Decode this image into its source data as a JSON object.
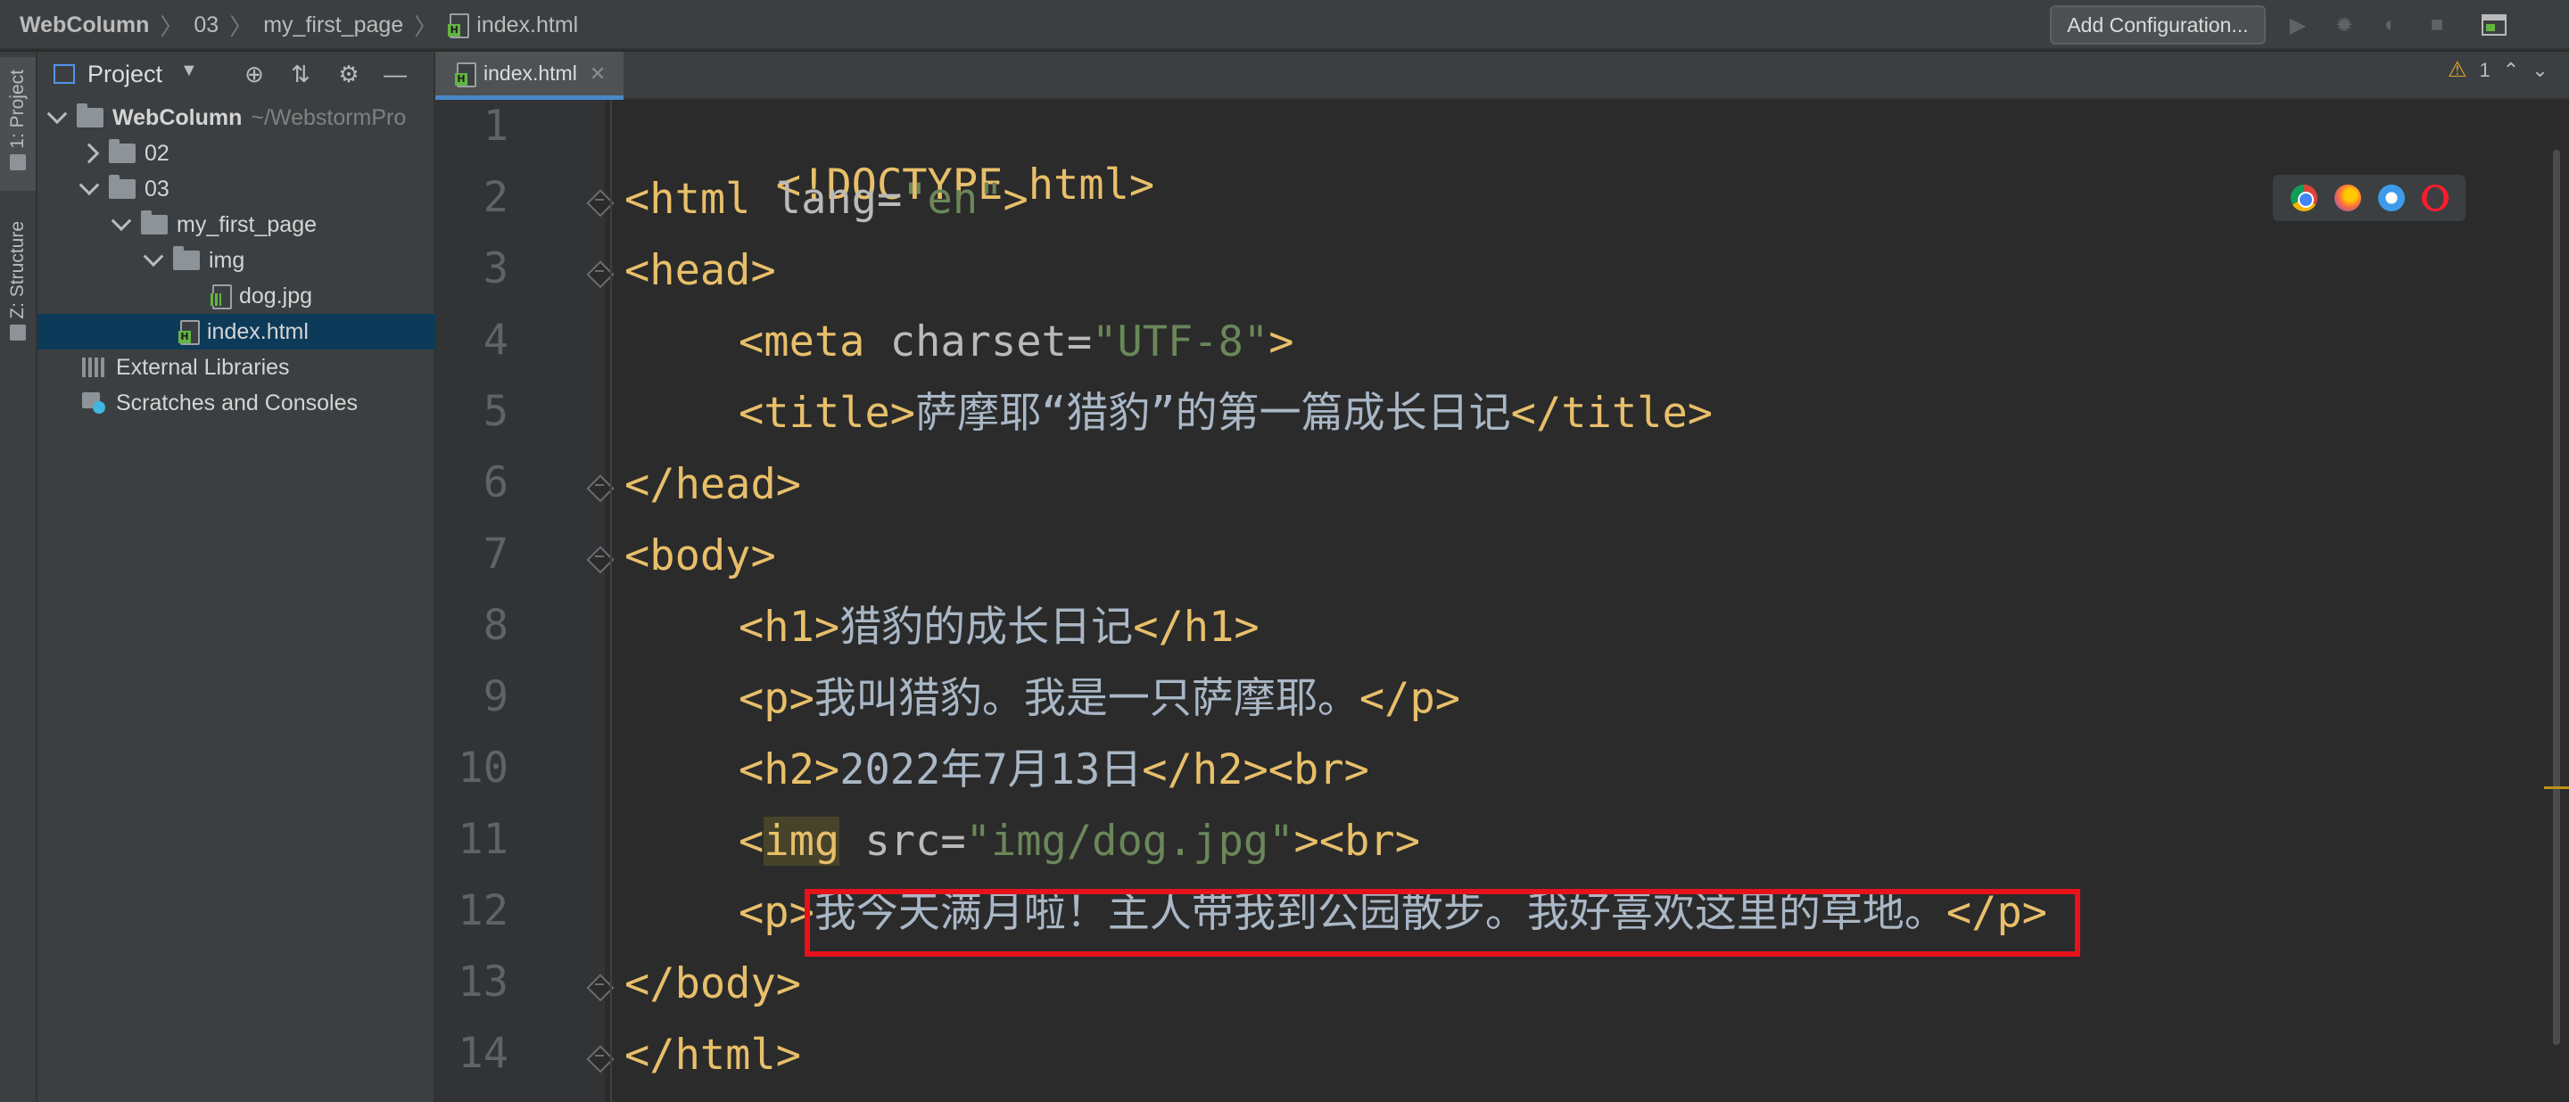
{
  "breadcrumb": [
    {
      "label": "WebColumn"
    },
    {
      "label": "03"
    },
    {
      "label": "my_first_page"
    },
    {
      "label": "index.html"
    }
  ],
  "toolbar": {
    "add_configuration": "Add Configuration...",
    "icons": [
      "run-icon",
      "debug-icon",
      "coverage-icon",
      "stop-icon",
      "layout-icon"
    ]
  },
  "side_stripe": {
    "project": "1: Project",
    "structure": "Z: Structure"
  },
  "project_panel": {
    "title": "Project",
    "tree": [
      {
        "label": "WebColumn",
        "hint": "~/WebstormPro"
      },
      {
        "label": "02"
      },
      {
        "label": "03"
      },
      {
        "label": "my_first_page"
      },
      {
        "label": "img"
      },
      {
        "label": "dog.jpg"
      },
      {
        "label": "index.html"
      },
      {
        "label": "External Libraries"
      },
      {
        "label": "Scratches and Consoles"
      }
    ]
  },
  "editor": {
    "tab": "index.html",
    "warnings": "1",
    "line_numbers": [
      "1",
      "2",
      "3",
      "4",
      "5",
      "6",
      "7",
      "8",
      "9",
      "10",
      "11",
      "12",
      "13",
      "14"
    ],
    "code": {
      "l1": "<!DOCTYPE html>",
      "l2_tag": "<html ",
      "l2_attr": "lang=",
      "l2_val": "\"en\"",
      "l2_end": ">",
      "l3": "<head>",
      "l4_tag": "<meta ",
      "l4_attr": "charset=",
      "l4_val": "\"UTF-8\"",
      "l4_end": ">",
      "l5_open": "<title>",
      "l5_text": "萨摩耶“猎豹”的第一篇成长日记",
      "l5_close": "</title>",
      "l6": "</head>",
      "l7": "<body>",
      "l8_open": "<h1>",
      "l8_text": "猎豹的成长日记",
      "l8_close": "</h1>",
      "l9_open": "<p>",
      "l9_text": "我叫猎豹。我是一只萨摩耶。",
      "l9_close": "</p>",
      "l10_open": "<h2>",
      "l10_text": "2022年7月13日",
      "l10_close": "</h2><br>",
      "l11_lt": "<",
      "l11_img": "img",
      "l11_attr": " src=",
      "l11_val": "\"img/dog.jpg\"",
      "l11_end": "><br>",
      "l12_open": "<p>",
      "l12_text": "我今天满月啦！主人带我到公园散步。我好喜欢这里的草地。",
      "l12_close": "</p>",
      "l13": "</body>",
      "l14": "</html>"
    }
  },
  "colors": {
    "tag": "#e8bf6a",
    "string": "#6a8759",
    "text": "#a9b7c6",
    "highlight_box": "#e8121b",
    "selection": "#0d3a58"
  }
}
